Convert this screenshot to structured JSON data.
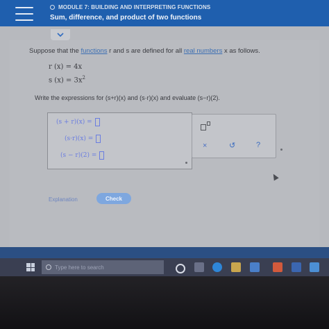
{
  "header": {
    "module": "MODULE 7: BUILDING AND INTERPRETING FUNCTIONS",
    "title": "Sum, difference, and product of two functions"
  },
  "problem": {
    "intro_prefix": "Suppose that the ",
    "intro_link1": "functions",
    "intro_mid": " r and s are defined for all ",
    "intro_link2": "real numbers",
    "intro_suffix": " x as follows.",
    "eq_r": "r (x) = 4x",
    "eq_s_base": "s (x) = 3x",
    "eq_s_exp": "2",
    "task": "Write the expressions for (s+r)(x) and (s·r)(x) and evaluate (s−r)(2)."
  },
  "answers": [
    {
      "label": "(s + r)(x) ="
    },
    {
      "label": "(s·r)(x) ="
    },
    {
      "label": "(s − r)(2) ="
    }
  ],
  "tools": {
    "clear": "×",
    "undo": "↺",
    "help": "?"
  },
  "buttons": {
    "explanation": "Explanation",
    "check": "Check"
  },
  "taskbar": {
    "search_placeholder": "Type here to search"
  },
  "colors": {
    "header": "#1f5fae",
    "accent": "#6a7de0",
    "check": "#7ea7df"
  }
}
